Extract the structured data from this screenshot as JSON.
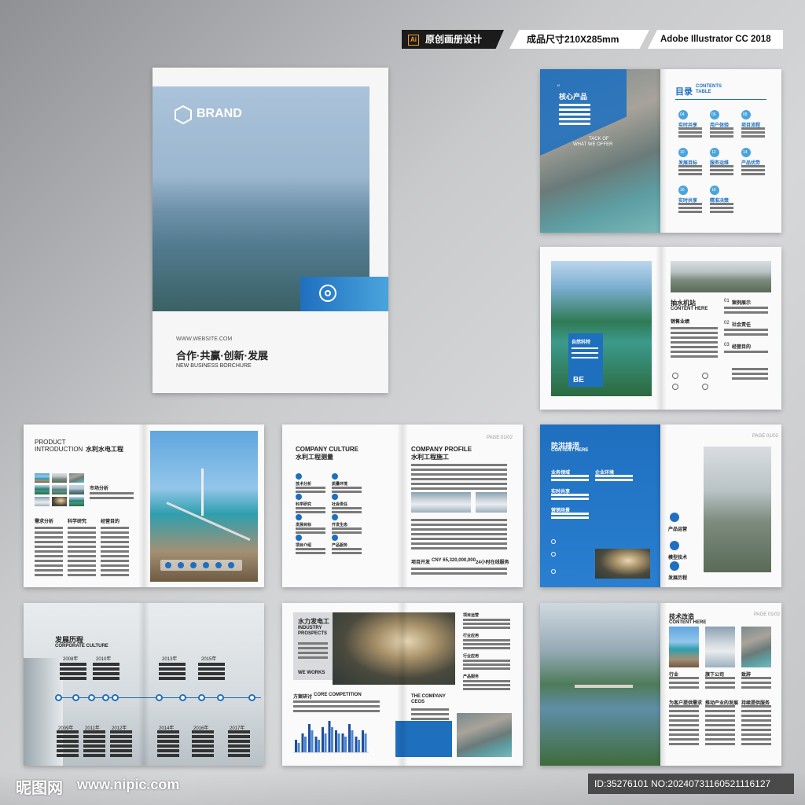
{
  "topbar": {
    "ai_badge": "Ai",
    "design_label": "原创画册设计",
    "size_label": "成品尺寸210X285mm",
    "software_label": "Adobe Illustrator CC 2018"
  },
  "cover": {
    "brand": "BRAND",
    "website": "WWW.WEBSITE.COM",
    "slogan": "合作·共赢·创新·发展",
    "subtitle": "NEW BUSINESS BORCHURE"
  },
  "spread_products": {
    "title": "核心产品",
    "caption_1": "TACK OF",
    "caption_2": "WHAT WE OFFER"
  },
  "spread_contents": {
    "title_cn": "目录",
    "title_en_1": "CONTENTS",
    "title_en_2": "TABLE",
    "items": [
      {
        "num": "04",
        "label": "实时共享"
      },
      {
        "num": "06",
        "label": "用户体验"
      },
      {
        "num": "08",
        "label": "项目流程"
      },
      {
        "num": "10",
        "label": "发展目标"
      },
      {
        "num": "12",
        "label": "服务运维"
      },
      {
        "num": "14",
        "label": "产品优势"
      },
      {
        "num": "16",
        "label": "实时共享"
      },
      {
        "num": "18",
        "label": "精准决策"
      }
    ]
  },
  "spread_pump": {
    "box_title": "自然科特",
    "box_letters": "BE",
    "title_cn": "抽水机站",
    "title_en": "CONTENT HERE",
    "list": [
      {
        "num": "01",
        "label": "案例展示"
      },
      {
        "num": "02",
        "label": "社会责任"
      },
      {
        "num": "03",
        "label": "经营目的"
      }
    ],
    "sales_label": "销售业绩"
  },
  "spread_intro": {
    "title_1": "PRODUCT",
    "title_2": "INTRODUCTION",
    "title_cn": "水利水电工程",
    "market_label": "市场分析",
    "col_labels": [
      "需求分析",
      "科学研究",
      "经营目的"
    ]
  },
  "spread_culture": {
    "title_en": "COMPANY CULTURE",
    "title_cn": "水利工程测量",
    "items": [
      "技术分析",
      "质量环境",
      "科学研究",
      "社会责任",
      "发展目标",
      "开发生态",
      "项目介绍",
      "产品服务"
    ],
    "profile_en": "COMPANY PROFILE",
    "profile_cn": "水利工程施工",
    "page_no": "PAGE:01/02",
    "stat_1": "项目开发",
    "stat_2": "CNY 65,320,000,000",
    "stat_3": "24小时在线服务"
  },
  "spread_flood": {
    "title_cn": "防洪排涝",
    "title_en": "CONTENT HERE",
    "labels": [
      "业务领域",
      "企业环境",
      "实时共享",
      "营销场景"
    ],
    "page_no": "PAGE 01/02",
    "icon_labels": [
      "产品运营",
      "模型技术",
      "发展历程"
    ]
  },
  "spread_history": {
    "title_cn": "发展历程",
    "title_en": "CORPORATE CULTURE",
    "years_top": [
      "2008年",
      "2010年",
      "2013年",
      "2015年"
    ],
    "years_bottom": [
      "2009年",
      "2011年",
      "2012年",
      "2014年",
      "2016年",
      "2017年"
    ]
  },
  "spread_hydro": {
    "title_cn": "水力发电工",
    "title_en_1": "INDUSTRY",
    "title_en_2": "PROSPECTS",
    "we_works": "WE WORKS",
    "competition_cn": "方案研讨",
    "competition_en": "CORE COMPETITION",
    "ceo_1": "THE COMPANY",
    "ceo_2": "CEOS",
    "side_labels": [
      "项目运营",
      "行业应用",
      "行业应用",
      "产品服务"
    ]
  },
  "spread_tech": {
    "title_cn": "技术改造",
    "title_en": "CONTENT HERE",
    "page_no": "PAGE 01/02",
    "labels": [
      "行业",
      "旗下公司",
      "致辞"
    ],
    "bottom_labels": [
      "为客户提供需求",
      "推动产业的发展",
      "持续提供服务"
    ]
  },
  "chart_data": {
    "type": "bar",
    "categories": [
      "",
      "",
      "",
      "",
      "",
      "",
      "",
      "",
      "",
      "",
      ""
    ],
    "series": [
      {
        "values": [
          4,
          6,
          9,
          5,
          8,
          10,
          7,
          6,
          9,
          5,
          7
        ]
      },
      {
        "values": [
          3,
          5,
          7,
          4,
          6,
          8,
          6,
          5,
          7,
          4,
          6
        ]
      }
    ],
    "colors": [
      "#1f4e9c",
      "#4a86d6"
    ]
  },
  "footer": {
    "logo_cn": "昵图网",
    "logo_url": "www.nipic.com",
    "id_text": "ID:35276101 NO:20240731160521116127"
  },
  "colors": {
    "accent": "#1f6fbf",
    "accent_light": "#4aa4dc"
  }
}
